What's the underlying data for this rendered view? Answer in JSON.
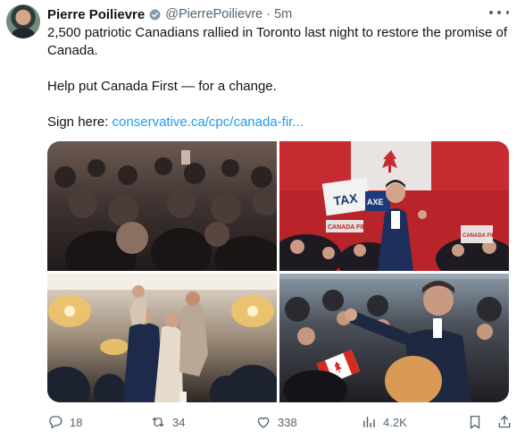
{
  "author": {
    "display_name": "Pierre Poilievre",
    "handle": "@PierrePoilievre",
    "separator": "·",
    "time": "5m",
    "verified": true
  },
  "tweet": {
    "line1": "2,500 patriotic Canadians rallied in Toronto last night to restore the promise of Canada.",
    "line2": "Help put Canada First — for a change.",
    "sign_prefix": "Sign here: ",
    "link_text": "conservative.ca/cpc/canada-fir..."
  },
  "photos": {
    "p2_sign_tax": "TAX",
    "p2_sign_axe": "AXE",
    "p2_banner1": "CANADA FIRST",
    "p2_banner2": "CANADA FIRST"
  },
  "actions": {
    "replies": "18",
    "reposts": "34",
    "likes": "338",
    "views": "4.2K"
  },
  "colors": {
    "accent": "#1d9bf0",
    "muted": "#536471",
    "text": "#0f1419"
  }
}
